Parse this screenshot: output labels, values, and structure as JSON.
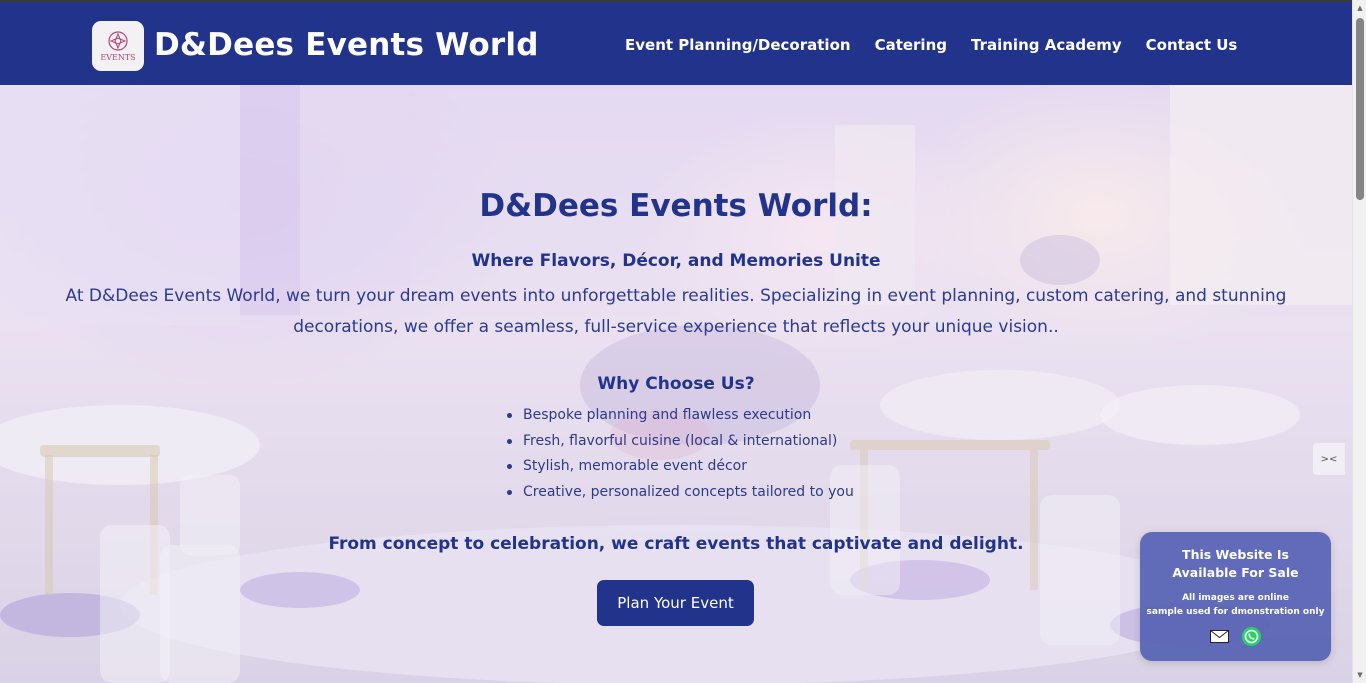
{
  "nav": {
    "logo_text": "EVENTS",
    "brand": "D&Dees Events World",
    "links": [
      "Event Planning/Decoration",
      "Catering",
      "Training Academy",
      "Contact Us"
    ]
  },
  "hero": {
    "title": "D&Dees Events World:",
    "subtitle": "Where Flavors, Décor, and Memories Unite",
    "intro": "At D&Dees Events World, we turn your dream events into unforgettable realities. Specializing in event planning, custom catering, and stunning decorations, we offer a seamless, full-service experience that reflects your unique vision..",
    "why_title": "Why Choose Us?",
    "why_items": [
      "Bespoke planning and flawless execution",
      "Fresh, flavorful cuisine (local & international)",
      "Stylish, memorable event décor",
      "Creative, personalized concepts tailored to you"
    ],
    "tagline": "From concept to celebration, we craft events that captivate and delight.",
    "cta": "Plan Your Event"
  },
  "sale_card": {
    "title_line1": "This Website Is",
    "title_line2": "Available For Sale",
    "note_line1": "All images are online",
    "note_line2": "sample used for dmonstration only",
    "icons": [
      "mail-icon",
      "whatsapp-icon"
    ]
  },
  "colors": {
    "nav_bg": "#22338c",
    "primary_text": "#22338c",
    "cta_bg": "#22338c",
    "sale_card_bg": "#5662b4",
    "whatsapp_green": "#25d366"
  }
}
